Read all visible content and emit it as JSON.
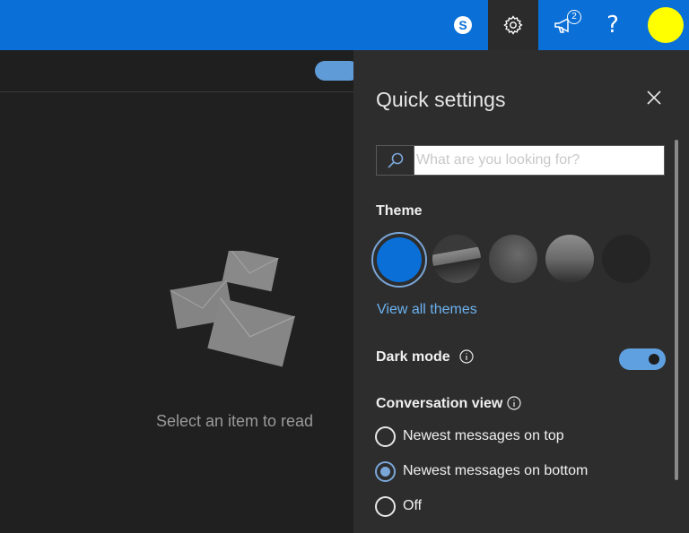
{
  "topbar": {
    "notifications_count": "2",
    "help_label": "?"
  },
  "reading_pane": {
    "empty_message": "Select an item to read"
  },
  "quick_settings": {
    "title": "Quick settings",
    "search": {
      "placeholder": "What are you looking for?",
      "value": ""
    },
    "theme_label": "Theme",
    "themes": [
      {
        "name": "Blue",
        "selected": true,
        "color": "#0a6fd6"
      },
      {
        "name": "Landscape",
        "selected": false
      },
      {
        "name": "Texture",
        "selected": false
      },
      {
        "name": "Palms",
        "selected": false
      },
      {
        "name": "Dark",
        "selected": false
      }
    ],
    "view_all_themes": "View all themes",
    "dark_mode_label": "Dark mode",
    "dark_mode_on": true,
    "conversation_view_label": "Conversation view",
    "conversation_options": [
      {
        "label": "Newest messages on top",
        "checked": false
      },
      {
        "label": "Newest messages on bottom",
        "checked": true
      },
      {
        "label": "Off",
        "checked": false
      }
    ]
  },
  "colors": {
    "accent": "#0a6fd6",
    "link": "#6cb2f0",
    "avatar": "#ffff00"
  }
}
